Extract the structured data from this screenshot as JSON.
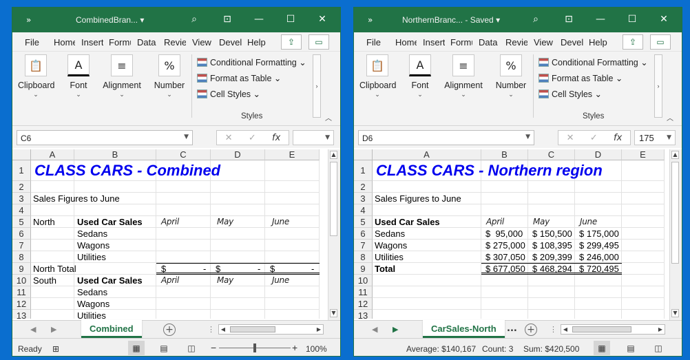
{
  "windows": [
    {
      "title": "CombinedBran...",
      "menu": [
        "File",
        "Home",
        "Insert",
        "Formulas",
        "Data",
        "Review",
        "View",
        "Developer",
        "Help"
      ],
      "ribbon": {
        "clipboard": "Clipboard",
        "font": "Font",
        "alignment": "Alignment",
        "number": "Number",
        "cond": "Conditional Formatting",
        "fmt_table": "Format as Table",
        "cell_styles": "Cell Styles",
        "styles": "Styles"
      },
      "namebox": "C6",
      "fxvalue": "",
      "columns": [
        "A",
        "B",
        "C",
        "D",
        "E"
      ],
      "rows": [
        "1",
        "2",
        "3",
        "4",
        "5",
        "6",
        "7",
        "8",
        "9",
        "10",
        "11",
        "12",
        "13"
      ],
      "cells": {
        "title": "CLASS CARS - Combined",
        "subtitle": "Sales Figures to June",
        "r5a": "North",
        "r5b": "Used Car Sales",
        "r5c": "April",
        "r5d": "May",
        "r5e": "June",
        "r6b": "Sedans",
        "r7b": "Wagons",
        "r8b": "Utilities",
        "r9a": "North Total",
        "r9c1": "$",
        "r9c2": "-",
        "r9d1": "$",
        "r9d2": "-",
        "r9e1": "$",
        "r9e2": "-",
        "r10a": "South",
        "r10b": "Used Car Sales",
        "r10c": "April",
        "r10d": "May",
        "r10e": "June",
        "r11b": "Sedans",
        "r12b": "Wagons",
        "r13b": "Utilities"
      },
      "sheet_tab": "Combined",
      "status": {
        "ready": "Ready",
        "zoom": "100%"
      }
    },
    {
      "title": "NorthernBranc...  -  Saved",
      "menu": [
        "File",
        "Home",
        "Insert",
        "Formulas",
        "View",
        "Review",
        "View",
        "Developer",
        "Help"
      ],
      "ribbon": {
        "clipboard": "Clipboard",
        "font": "Font",
        "alignment": "Alignment",
        "number": "Number",
        "cond": "Conditional Formatting",
        "fmt_table": "Format as Table",
        "cell_styles": "Cell Styles",
        "styles": "Styles"
      },
      "namebox": "D6",
      "fxvalue": "175",
      "columns": [
        "A",
        "B",
        "C",
        "D",
        "E"
      ],
      "rows": [
        "1",
        "2",
        "3",
        "4",
        "5",
        "6",
        "7",
        "8",
        "9",
        "10",
        "11",
        "12",
        "13"
      ],
      "cells": {
        "title": "CLASS CARS - Northern region",
        "subtitle": "Sales Figures to June",
        "r5a": "Used Car Sales",
        "r5b": "April",
        "r5c": "May",
        "r5d": "June",
        "r6a": "Sedans",
        "r6b": "$  95,000",
        "r6c": "$ 150,500",
        "r6d": "$ 175,000",
        "r7a": "Wagons",
        "r7b": "$ 275,000",
        "r7c": "$ 108,395",
        "r7d": "$ 299,495",
        "r8a": "Utilities",
        "r8b": "$ 307,050",
        "r8c": "$ 209,399",
        "r8d": "$ 246,000",
        "r9a": "Total",
        "r9b": "$ 677,050",
        "r9c": "$ 468,294",
        "r9d": "$ 720,495"
      },
      "sheet_tab": "CarSales-North",
      "ellipsis": "...",
      "status": {
        "average": "Average:  $140,167",
        "count": "Count: 3",
        "sum": "Sum:  $420,500"
      }
    }
  ]
}
